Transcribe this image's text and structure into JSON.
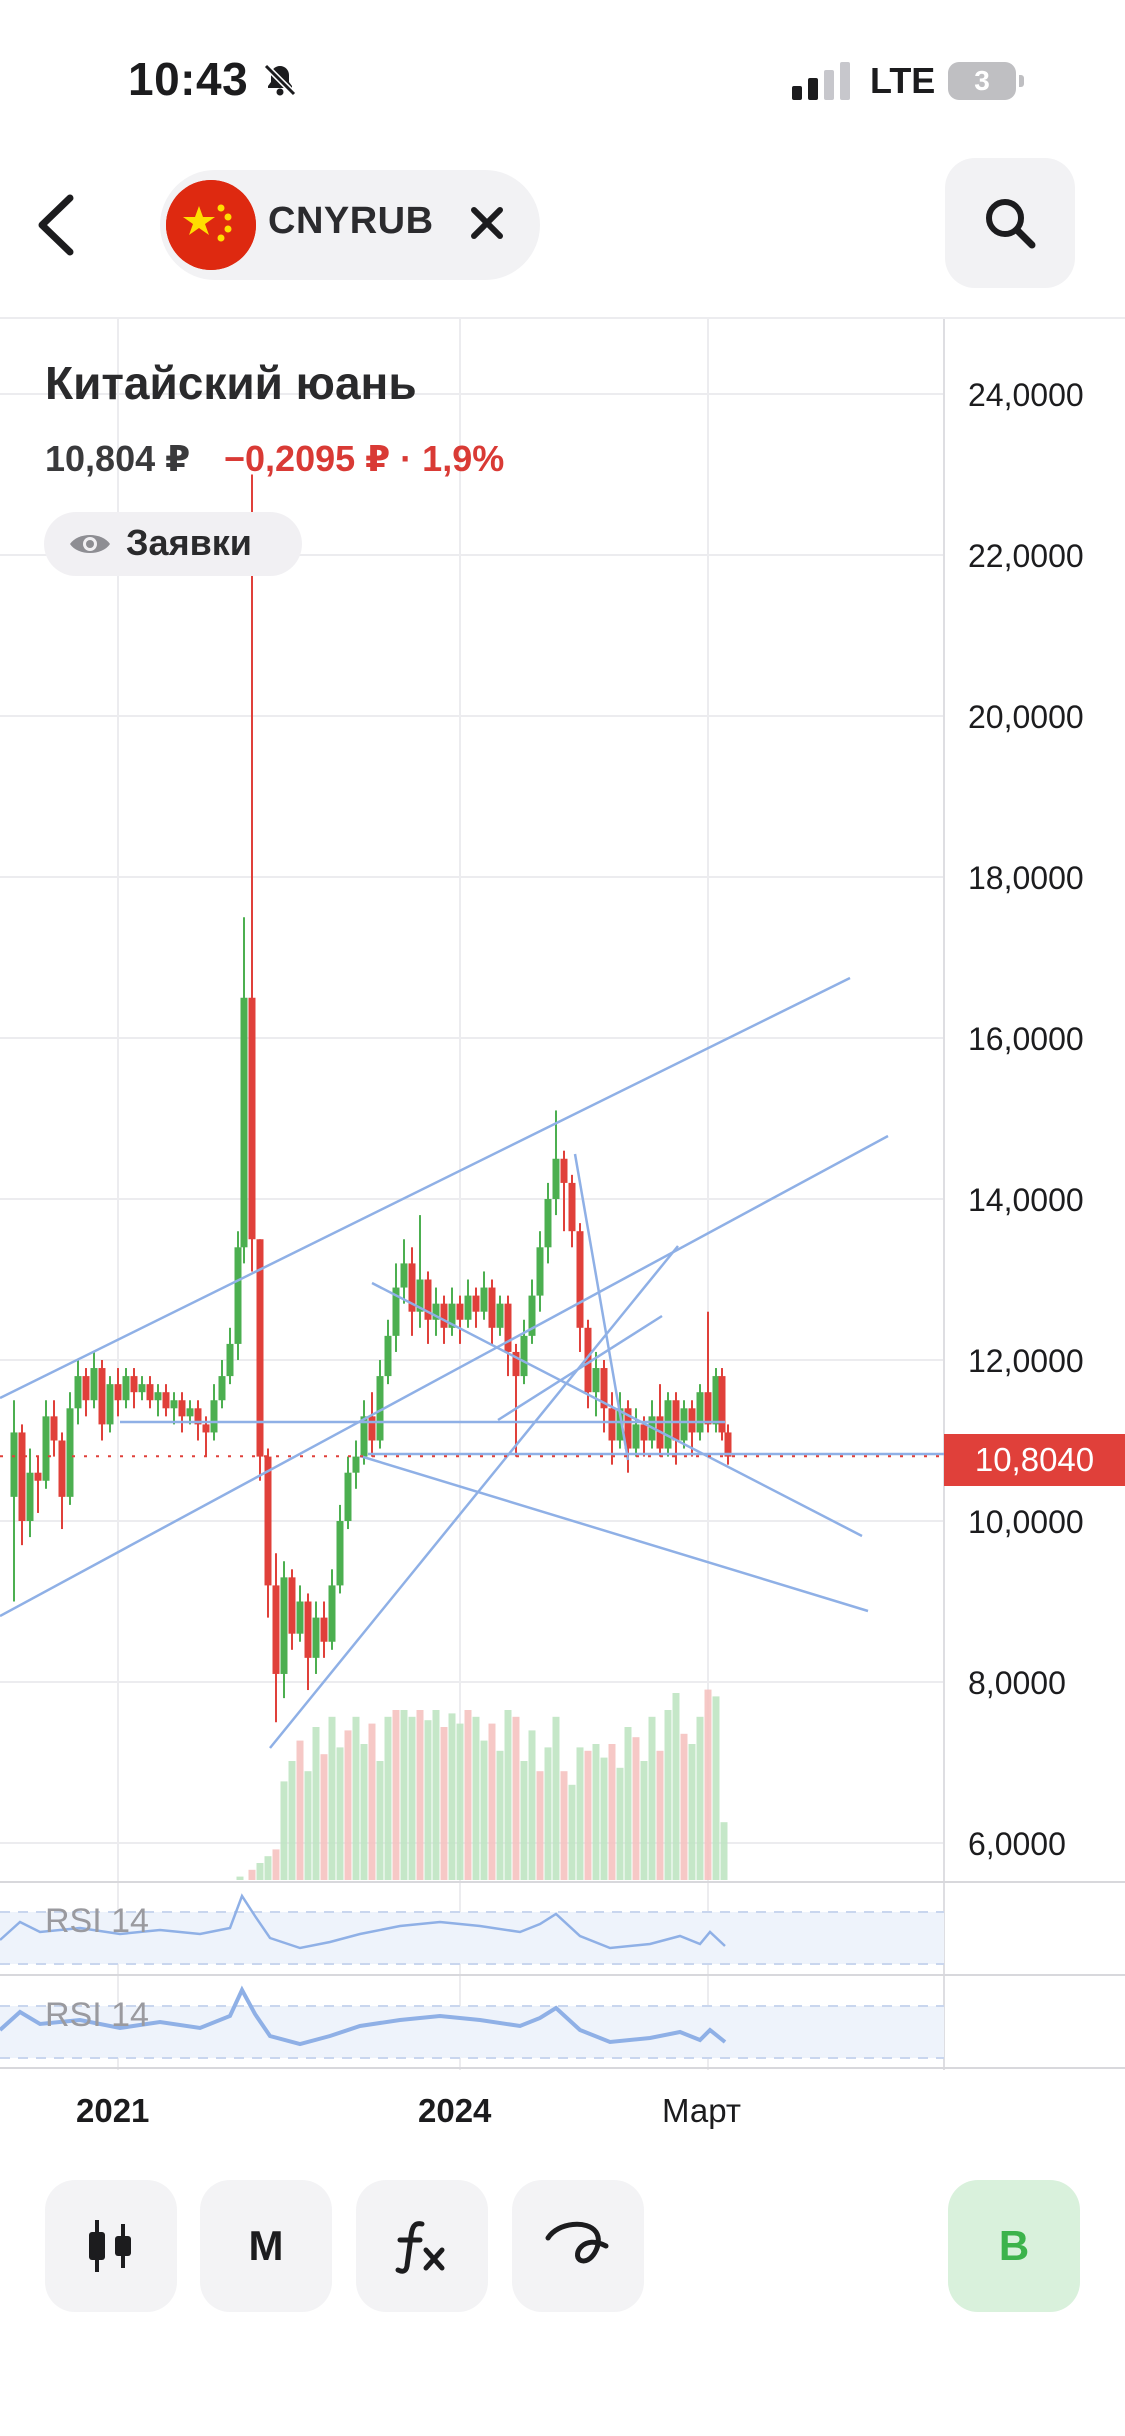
{
  "status_bar": {
    "time": "10:43",
    "network": "LTE",
    "battery": "3"
  },
  "header": {
    "ticker": "CNYRUB",
    "icons": [
      "back-chevron-icon",
      "china-flag-icon",
      "close-icon",
      "search-icon"
    ]
  },
  "instrument": {
    "name": "Китайский юань",
    "price": "10,804 ₽",
    "change": "−0,2095 ₽ · 1,9%",
    "orders_label": "Заявки"
  },
  "chart": {
    "price_axis": [
      "24,0000",
      "22,0000",
      "20,0000",
      "18,0000",
      "16,0000",
      "14,0000",
      "12,0000",
      "10,0000",
      "8,0000",
      "6,0000"
    ],
    "current_price_tag": "10,8040",
    "indicator_labels": [
      "RSI 14",
      "RSI 14"
    ],
    "time_axis": [
      "2021",
      "2024",
      "Март"
    ],
    "colors": {
      "up": "#4caf50",
      "down": "#e0403a",
      "drawing": "#8fb0e6",
      "price_tag": "#e0403a"
    }
  },
  "chart_data": {
    "type": "candlestick",
    "y_axis_ticks": [
      24,
      22,
      20,
      18,
      16,
      14,
      12,
      10,
      8,
      6
    ],
    "ylim": [
      6,
      24.5
    ],
    "current_price": 10.804,
    "x_ticks": [
      "2021",
      "2024",
      "Март"
    ]
  },
  "toolbar": {
    "items": [
      {
        "name": "chart-type-button",
        "label": "",
        "icon": "candles-icon"
      },
      {
        "name": "interval-button",
        "label": "M",
        "icon": ""
      },
      {
        "name": "indicators-button",
        "label": "",
        "icon": "fx-icon"
      },
      {
        "name": "drawing-tools-button",
        "label": "",
        "icon": "draw-icon"
      }
    ],
    "buy_label": "B"
  }
}
